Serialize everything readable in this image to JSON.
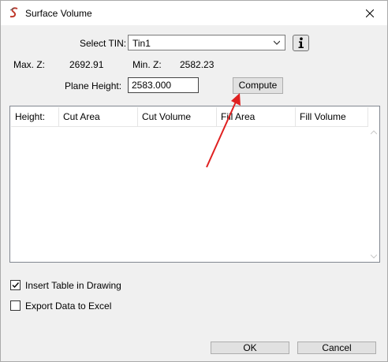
{
  "window": {
    "title": "Surface Volume"
  },
  "tin": {
    "label": "Select TIN:",
    "value": "Tin1"
  },
  "stats": {
    "max_z_label": "Max. Z:",
    "max_z_value": "2692.91",
    "min_z_label": "Min. Z:",
    "min_z_value": "2582.23"
  },
  "plane": {
    "label": "Plane Height:",
    "value": "2583.000"
  },
  "buttons": {
    "compute": "Compute",
    "ok": "OK",
    "cancel": "Cancel"
  },
  "table": {
    "columns": [
      "Height:",
      "Cut Area",
      "Cut Volume",
      "Fill Area",
      "Fill Volume"
    ],
    "rows": []
  },
  "options": {
    "insert_table": {
      "label": "Insert Table in Drawing",
      "checked": true
    },
    "export_excel": {
      "label": "Export Data to Excel",
      "checked": false
    }
  },
  "colors": {
    "annotation_arrow": "#e02020",
    "app_icon": "#c0392b"
  }
}
